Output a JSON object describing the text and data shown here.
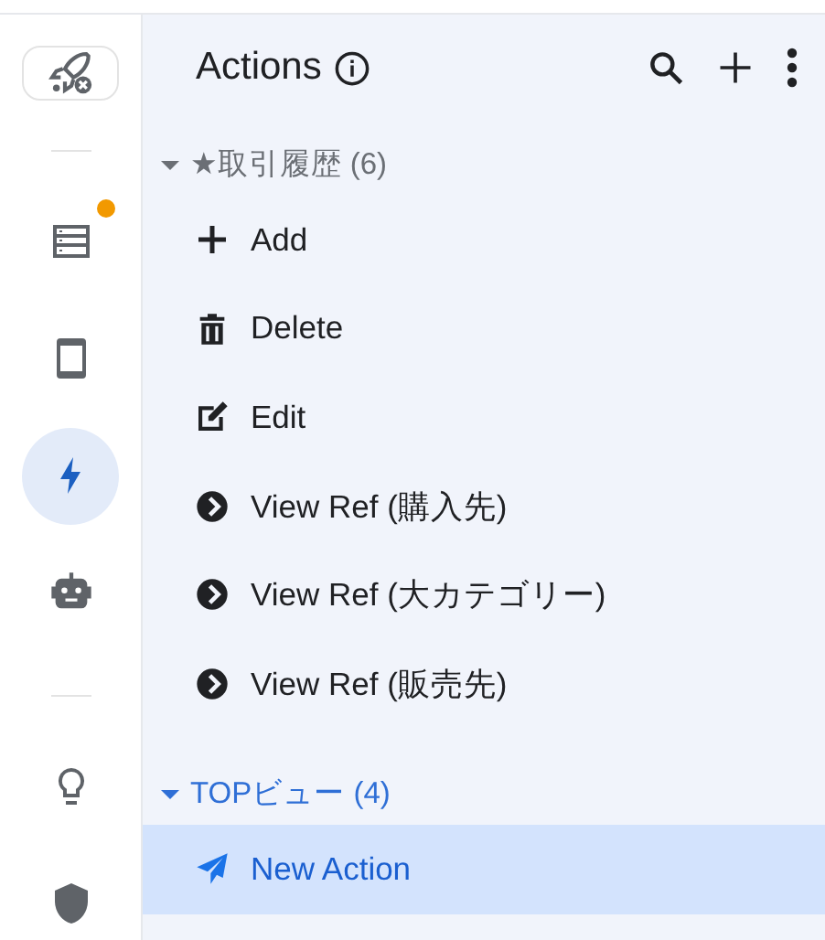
{
  "rail": {
    "items": [
      {
        "kind": "table",
        "selected": false,
        "notification": true
      },
      {
        "kind": "phone",
        "selected": false,
        "notification": false
      },
      {
        "kind": "bolt",
        "selected": true,
        "notification": false
      },
      {
        "kind": "robot",
        "selected": false,
        "notification": false
      },
      {
        "kind": "divider"
      },
      {
        "kind": "bulb",
        "selected": false,
        "notification": false
      },
      {
        "kind": "shield",
        "selected": false,
        "notification": false
      }
    ]
  },
  "panel": {
    "title": "Actions"
  },
  "groups": [
    {
      "title": "★取引履歴 (6)",
      "expanded": true,
      "active": false,
      "items": [
        {
          "label": "Add",
          "kind": "add",
          "selected": false
        },
        {
          "label": "Delete",
          "kind": "delete",
          "selected": false
        },
        {
          "label": "Edit",
          "kind": "edit",
          "selected": false
        },
        {
          "label": "View Ref (購入先)",
          "kind": "ref",
          "selected": false
        },
        {
          "label": "View Ref (大カテゴリー)",
          "kind": "ref",
          "selected": false
        },
        {
          "label": "View Ref (販売先)",
          "kind": "ref",
          "selected": false
        }
      ]
    },
    {
      "title": "TOPビュー (4)",
      "expanded": true,
      "active": true,
      "items": [
        {
          "label": "New Action",
          "kind": "send",
          "selected": true
        }
      ]
    }
  ]
}
